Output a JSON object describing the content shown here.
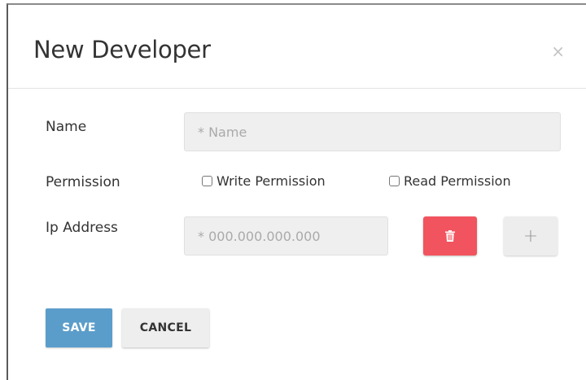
{
  "modal": {
    "title": "New Developer",
    "close_glyph": "×"
  },
  "form": {
    "name": {
      "label": "Name",
      "placeholder": "* Name",
      "value": ""
    },
    "permission": {
      "label": "Permission",
      "options": [
        {
          "label": "Write Permission",
          "checked": false
        },
        {
          "label": "Read Permission",
          "checked": false
        }
      ]
    },
    "ip_address": {
      "label": "Ip Address",
      "placeholder": "* 000.000.000.000",
      "value": ""
    },
    "delete_icon": "trash-icon",
    "add_glyph": "+"
  },
  "actions": {
    "save_label": "SAVE",
    "cancel_label": "CANCEL"
  },
  "colors": {
    "save": "#5b9dca",
    "delete": "#f1545f",
    "input_bg": "#efefef",
    "secondary_button": "#eeeeee"
  }
}
